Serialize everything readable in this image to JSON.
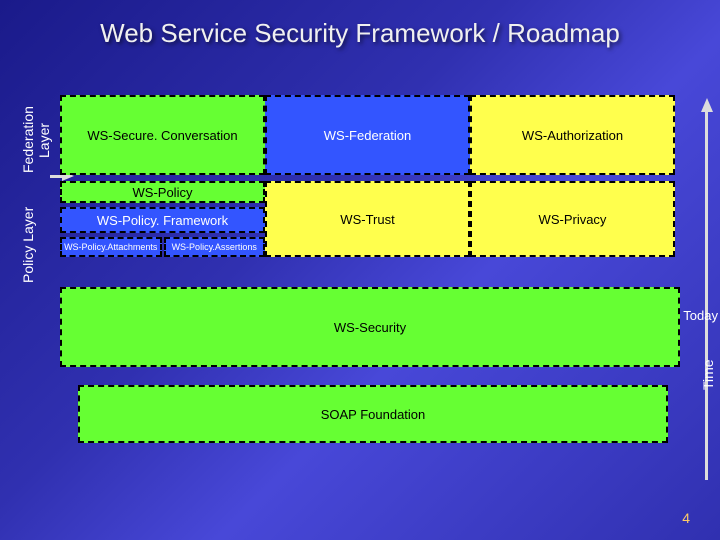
{
  "title": "Web Service Security Framework / Roadmap",
  "labels": {
    "federation": "Federation\nLayer",
    "policy": "Policy\nLayer",
    "time": "Time",
    "today": "Today"
  },
  "federation_row": {
    "c1": "WS-Secure. Conversation",
    "c2": "WS-Federation",
    "c3": "WS-Authorization"
  },
  "policy_row": {
    "top": "WS-Policy",
    "mid": "WS-Policy. Framework",
    "sub1": "WS-Policy.Attachments",
    "sub2": "WS-Policy.Assertions",
    "c2": "WS-Trust",
    "c3": "WS-Privacy"
  },
  "security": "WS-Security",
  "soap": "SOAP Foundation",
  "slidenum": "4"
}
